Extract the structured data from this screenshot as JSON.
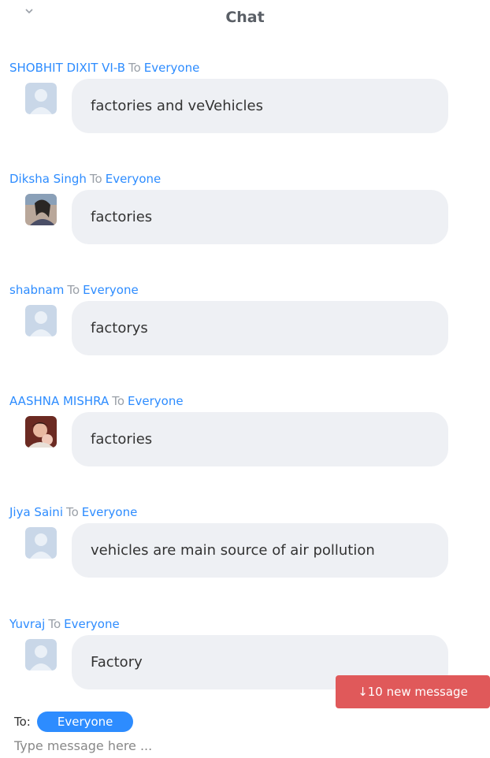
{
  "header": {
    "title": "Chat",
    "collapse_icon": "chevron-down-icon"
  },
  "messages": [
    {
      "sender": "SHOBHIT DIXIT VI-B",
      "to_word": "To",
      "recipient": "Everyone",
      "text": "factories and veVehicles",
      "avatar": "default"
    },
    {
      "sender": "Diksha Singh",
      "to_word": "To",
      "recipient": "Everyone",
      "text": "factories",
      "avatar": "photo"
    },
    {
      "sender": "shabnam",
      "to_word": "To",
      "recipient": "Everyone",
      "text": "factorys",
      "avatar": "default"
    },
    {
      "sender": "AASHNA MISHRA",
      "to_word": "To",
      "recipient": "Everyone",
      "text": "factories",
      "avatar": "photo"
    },
    {
      "sender": "Jiya Saini",
      "to_word": "To",
      "recipient": "Everyone",
      "text": "vehicles  are main source of air pollution",
      "avatar": "default"
    },
    {
      "sender": "Yuvraj",
      "to_word": "To",
      "recipient": "Everyone",
      "text": "Factory",
      "avatar": "default"
    }
  ],
  "new_messages": {
    "label": "↓10 new message"
  },
  "composer": {
    "to_label": "To:",
    "recipient": "Everyone",
    "placeholder": "Type message here ..."
  },
  "colors": {
    "accent": "#2d8cff",
    "alert": "#e0595a",
    "bubble": "#eef0f4"
  }
}
